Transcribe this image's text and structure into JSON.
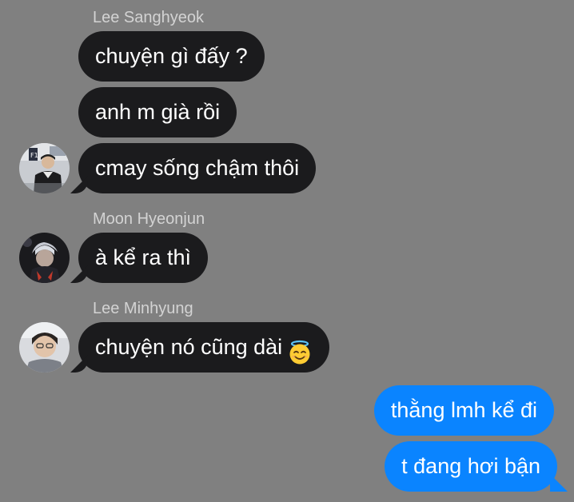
{
  "conversation": {
    "groups": [
      {
        "sender": "Lee Sanghyeok",
        "messages": [
          "chuyện gì đấy ?",
          "anh m già rồi",
          "cmay sống chậm thôi"
        ]
      },
      {
        "sender": "Moon Hyeonjun",
        "messages": [
          "à kể ra thì"
        ]
      },
      {
        "sender": "Lee Minhyung",
        "messages": [
          "chuyện nó cũng dài"
        ],
        "emoji": "smiling-face-with-halo"
      }
    ],
    "outgoing": [
      "thằng lmh kể đi",
      "t đang hơi bận"
    ]
  },
  "colors": {
    "background": "#808080",
    "incoming_bubble": "#1b1b1d",
    "outgoing_bubble": "#0a84ff",
    "sender_name": "#d3d3d3"
  }
}
